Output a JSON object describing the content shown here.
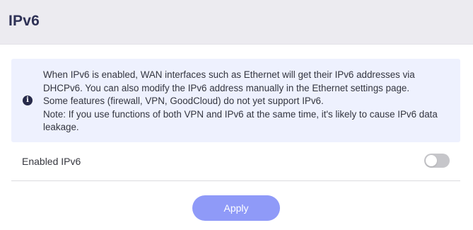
{
  "header": {
    "title": "IPv6"
  },
  "notice": {
    "icon": "info-circle-icon",
    "icon_glyph": "i",
    "lines": [
      "When IPv6 is enabled, WAN interfaces such as Ethernet will get their IPv6 addresses via DHCPv6. You can also modify the IPv6 address manually in the Ethernet settings page.",
      "Some features (firewall, VPN, GoodCloud) do not yet support IPv6.",
      "Note: If you use functions of both VPN and IPv6 at the same time, it's likely to cause IPv6 data leakage."
    ]
  },
  "settings": {
    "enable_label": "Enabled IPv6",
    "enable_state": false
  },
  "actions": {
    "apply_label": "Apply"
  },
  "colors": {
    "header_bg": "#ecebf0",
    "notice_bg": "#eef1fe",
    "button_bg": "#8f9af8",
    "toggle_off": "#c6c6ca"
  }
}
